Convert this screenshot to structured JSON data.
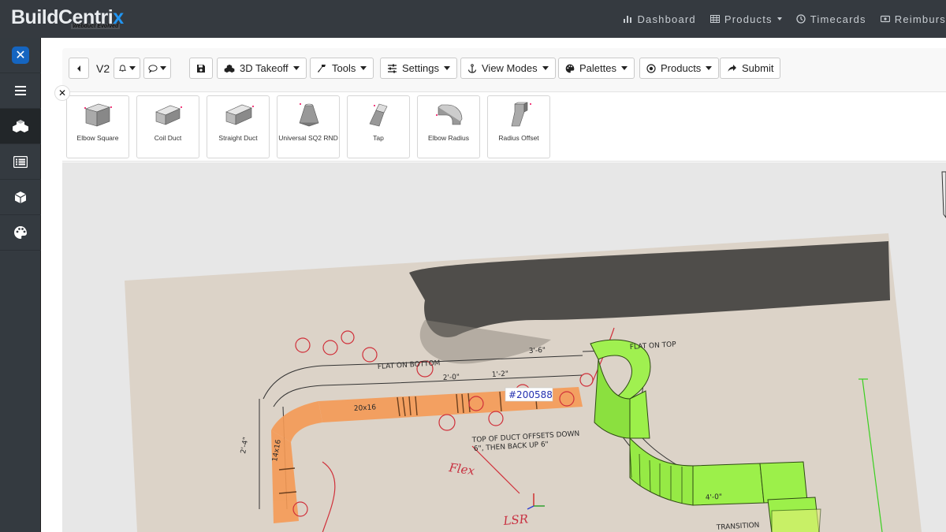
{
  "brand": {
    "name_main": "BuildCentri",
    "name_accent": "x",
    "tagline": "Webduct Evolved"
  },
  "topnav": [
    {
      "label": "Dashboard",
      "icon": "bar-chart-icon"
    },
    {
      "label": "Products",
      "icon": "grid-icon",
      "dropdown": true
    },
    {
      "label": "Timecards",
      "icon": "clock-icon"
    },
    {
      "label": "Reimburs",
      "icon": "money-icon"
    }
  ],
  "sidebar": [
    {
      "name": "app-logo",
      "icon": "x-logo-icon"
    },
    {
      "name": "menu",
      "icon": "hamburger-icon"
    },
    {
      "name": "shapes",
      "icon": "cubes-icon",
      "active": true
    },
    {
      "name": "list",
      "icon": "list-icon"
    },
    {
      "name": "box",
      "icon": "cube-icon"
    },
    {
      "name": "palette",
      "icon": "palette-icon"
    }
  ],
  "toolbar": {
    "version": "V2",
    "takeoff": "3D Takeoff",
    "tools": "Tools",
    "settings": "Settings",
    "view_modes": "View Modes",
    "palettes": "Palettes",
    "products": "Products",
    "submit": "Submit"
  },
  "palette": [
    {
      "label": "Elbow Square",
      "icon": "elbow-square-icon"
    },
    {
      "label": "Coil Duct",
      "icon": "coil-duct-icon"
    },
    {
      "label": "Straight Duct",
      "icon": "straight-duct-icon"
    },
    {
      "label": "Universal SQ2 RND",
      "icon": "transition-icon"
    },
    {
      "label": "Tap",
      "icon": "tap-icon"
    },
    {
      "label": "Elbow Radius",
      "icon": "elbow-radius-icon"
    },
    {
      "label": "Radius Offset",
      "icon": "radius-offset-icon"
    }
  ],
  "drawing": {
    "tag": "#200588",
    "notes": {
      "flat_on_bottom": "FLAT ON BOTTOM",
      "flat_on_top": "FLAT ON TOP",
      "offset_note_1": "TOP OF DUCT OFFSETS DOWN",
      "offset_note_2": "6\", THEN BACK UP 6\"",
      "dim_3_6": "3'-6\"",
      "dim_2_0": "2'-0\"",
      "dim_1_2": "1'-2\"",
      "dim_4_0": "4'-0\"",
      "dim_2_4": "2'-4\"",
      "duct_20x16": "20x16",
      "duct_14x16": "14x16",
      "transition": "TRANSITION",
      "flex": "Flex",
      "lsr": "LSR"
    },
    "colors": {
      "orange_overlay": "#f59a55",
      "green_model": "#9cf04a",
      "paper": "#ded6cc"
    }
  }
}
